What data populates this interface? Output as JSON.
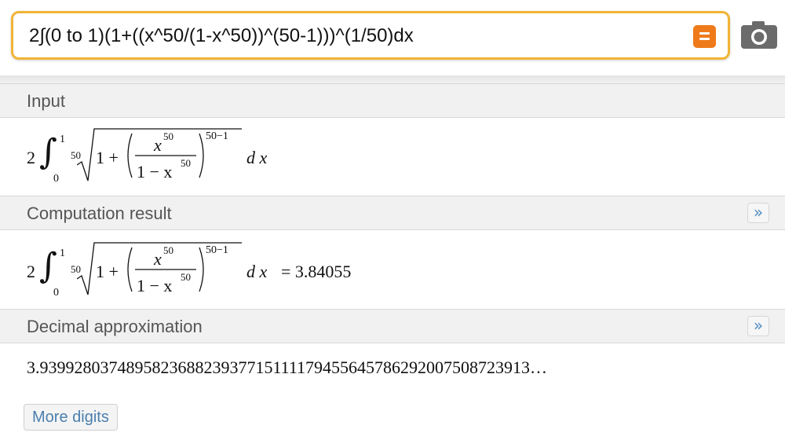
{
  "query": {
    "text": "2∫(0 to 1)(1+((x^50/(1-x^50))^(50-1)))^(1/50)dx",
    "submit_label": "="
  },
  "pods": {
    "input": {
      "title": "Input",
      "math": {
        "coef": "2",
        "upper": "1",
        "lower": "0",
        "root_index": "50",
        "one_plus": "1 +",
        "numerator": "x",
        "numerator_exp": "50",
        "denominator": "1 − x",
        "denominator_exp": "50",
        "outer_exp": "50−1",
        "dx": "d x"
      }
    },
    "computation": {
      "title": "Computation result",
      "more_label": "»",
      "result": "= 3.84055"
    },
    "decimal": {
      "title": "Decimal approximation",
      "more_label": "»",
      "value": "3.9399280374895823688239377151111794556457862920075087239​13…",
      "more_digits_label": "More digits"
    }
  },
  "icons": {
    "camera": "camera-icon",
    "equals": "equals-icon",
    "more": "double-chevron-right-icon"
  },
  "colors": {
    "query_border": "#f1b436",
    "equals_button": "#ef7a1a",
    "link": "#4a7fae"
  }
}
